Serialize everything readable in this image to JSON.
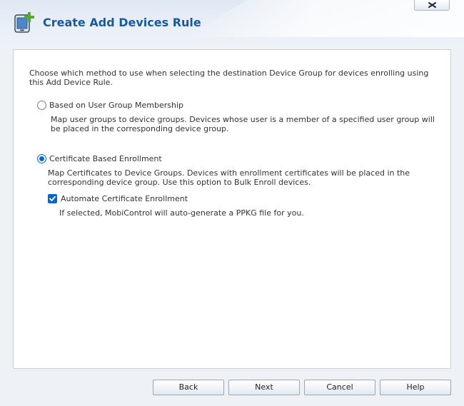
{
  "dialog": {
    "title": "Create Add Devices Rule",
    "close_label": "x"
  },
  "content": {
    "intro": "Choose which method to use when selecting the destination Device Group for devices enrolling using this Add Device Rule.",
    "options": [
      {
        "label": "Based on User Group Membership",
        "description": "Map user groups to device groups. Devices whose user is a member of a specified user group will be placed in the corresponding device group.",
        "selected": false
      },
      {
        "label": "Certificate Based Enrollment",
        "description": "Map Certificates to Device Groups. Devices with enrollment certificates will be placed in the corresponding device group. Use this option to Bulk Enroll devices.",
        "selected": true
      }
    ],
    "automate": {
      "label": "Automate Certificate Enrollment",
      "description": "If selected, MobiControl will auto-generate a PPKG file for you.",
      "checked": true
    }
  },
  "buttons": {
    "back": "Back",
    "next": "Next",
    "cancel": "Cancel",
    "help": "Help"
  },
  "colors": {
    "title": "#1a5a9c",
    "accent": "#0a66c2",
    "icon_plus": "#5aa832"
  }
}
